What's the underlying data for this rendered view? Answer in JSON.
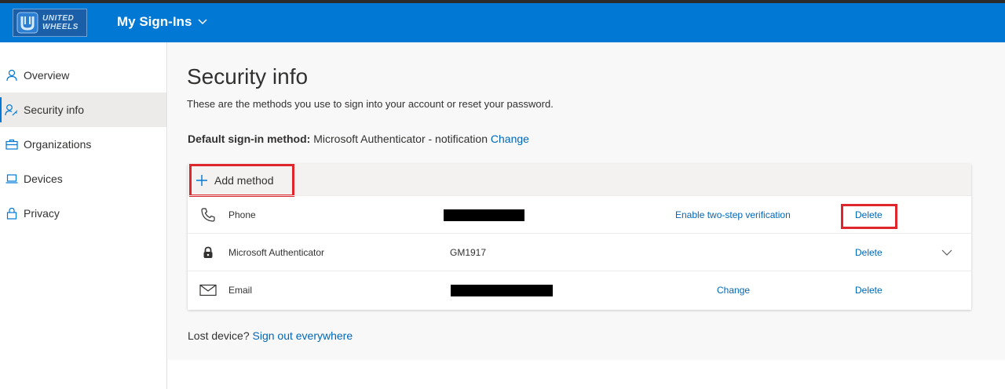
{
  "header": {
    "logo_text_line1": "UNITED",
    "logo_text_line2": "WHEELS",
    "app_title": "My Sign-Ins"
  },
  "sidebar": {
    "items": [
      {
        "label": "Overview",
        "icon": "person-icon",
        "active": false
      },
      {
        "label": "Security info",
        "icon": "person-key-icon",
        "active": true
      },
      {
        "label": "Organizations",
        "icon": "briefcase-icon",
        "active": false
      },
      {
        "label": "Devices",
        "icon": "laptop-icon",
        "active": false
      },
      {
        "label": "Privacy",
        "icon": "lock-icon",
        "active": false
      }
    ]
  },
  "main": {
    "title": "Security info",
    "description": "These are the methods you use to sign into your account or reset your password.",
    "default_method_label": "Default sign-in method:",
    "default_method_value": "Microsoft Authenticator - notification",
    "default_method_change": "Change",
    "add_method_label": "Add method",
    "methods": [
      {
        "icon": "phone-icon",
        "name": "Phone",
        "detail": "",
        "action": "Enable two-step verification",
        "delete": "Delete"
      },
      {
        "icon": "authenticator-lock-icon",
        "name": "Microsoft Authenticator",
        "detail": "GM1917",
        "action": "",
        "delete": "Delete"
      },
      {
        "icon": "mail-icon",
        "name": "Email",
        "detail": "",
        "action": "Change",
        "delete": "Delete"
      }
    ],
    "lost_device_text": "Lost device?",
    "sign_out_link": "Sign out everywhere"
  },
  "colors": {
    "accent": "#0078d4",
    "link": "#0067b8",
    "highlight": "#e0262d"
  }
}
